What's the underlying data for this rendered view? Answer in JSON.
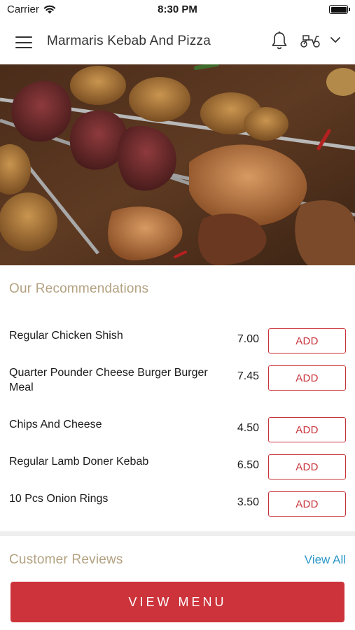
{
  "status_bar": {
    "carrier": "Carrier",
    "time": "8:30 PM"
  },
  "header": {
    "title": "Marmaris Kebab And Pizza",
    "icons": [
      "menu-icon",
      "bell-icon",
      "scooter-icon",
      "chevron-down-icon"
    ]
  },
  "hero": {
    "image": "grilled meat skewers with hasselback potatoes"
  },
  "recommendations": {
    "title": "Our Recommendations",
    "items": [
      {
        "name": "Regular Chicken Shish",
        "price": "7.00",
        "button": "ADD"
      },
      {
        "name": "Quarter Pounder Cheese Burger Burger Meal",
        "price": "7.45",
        "button": "ADD"
      },
      {
        "name": "Chips And Cheese",
        "price": "4.50",
        "button": "ADD"
      },
      {
        "name": "Regular Lamb Doner Kebab",
        "price": "6.50",
        "button": "ADD"
      },
      {
        "name": "10 Pcs Onion Rings",
        "price": "3.50",
        "button": "ADD"
      }
    ]
  },
  "reviews": {
    "title": "Customer Reviews",
    "view_all": "View All"
  },
  "footer": {
    "button": "VIEW MENU"
  },
  "colors": {
    "accent_red": "#cc333b",
    "section_title": "#b3a181",
    "link_blue": "#2d97c8"
  }
}
